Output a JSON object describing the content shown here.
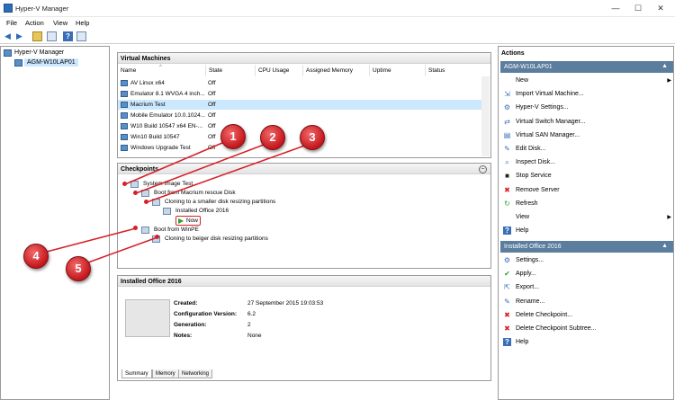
{
  "window": {
    "title": "Hyper-V Manager",
    "minimize": "—",
    "maximize": "☐",
    "close": "✕"
  },
  "menu": [
    "File",
    "Action",
    "View",
    "Help"
  ],
  "tree": {
    "root": "Hyper-V Manager",
    "host": "AGM-W10LAP01"
  },
  "vms": {
    "title": "Virtual Machines",
    "columns": [
      "Name",
      "State",
      "CPU Usage",
      "Assigned Memory",
      "Uptime",
      "Status"
    ],
    "rows": [
      {
        "name": "AV Linux x64",
        "state": "Off"
      },
      {
        "name": "Emulator 8.1 WVGA 4 inch...",
        "state": "Off"
      },
      {
        "name": "Macrium Test",
        "state": "Off"
      },
      {
        "name": "Mobile Emulator 10.0.1024...",
        "state": "Off"
      },
      {
        "name": "W10 Build 10547 x64 EN-...",
        "state": "Off"
      },
      {
        "name": "Win10 Build 10547",
        "state": "Off"
      },
      {
        "name": "Windows Upgrade Test",
        "state": "Off"
      }
    ]
  },
  "checkpoints": {
    "title": "Checkpoints",
    "items": [
      "System Image Test",
      "Boot from Macrium rescue Disk",
      "Cloning to a smaller disk resizing partitions",
      "Installed Office 2016",
      "Now",
      "Boot from WinPE",
      "Cloning to beiger disk resizing partitions"
    ]
  },
  "details": {
    "title": "Installed Office 2016",
    "created_label": "Created:",
    "created": "27 September 2015 19:03:53",
    "config_label": "Configuration Version:",
    "config": "6.2",
    "gen_label": "Generation:",
    "gen": "2",
    "notes_label": "Notes:",
    "notes": "None",
    "tabs": [
      "Summary",
      "Memory",
      "Networking"
    ]
  },
  "actions": {
    "title": "Actions",
    "host_header": "AGM-W10LAP01",
    "host_items": [
      {
        "label": "New",
        "icon": "none",
        "arrow": "▶"
      },
      {
        "label": "Import Virtual Machine...",
        "icon": "import-icon"
      },
      {
        "label": "Hyper-V Settings...",
        "icon": "settings-icon"
      },
      {
        "label": "Virtual Switch Manager...",
        "icon": "switch-icon"
      },
      {
        "label": "Virtual SAN Manager...",
        "icon": "san-icon"
      },
      {
        "label": "Edit Disk...",
        "icon": "edit-disk-icon"
      },
      {
        "label": "Inspect Disk...",
        "icon": "inspect-disk-icon"
      },
      {
        "label": "Stop Service",
        "icon": "stop-icon"
      },
      {
        "label": "Remove Server",
        "icon": "remove-icon"
      },
      {
        "label": "Refresh",
        "icon": "refresh-icon"
      },
      {
        "label": "View",
        "icon": "none",
        "arrow": "▶"
      },
      {
        "label": "Help",
        "icon": "help-icon"
      }
    ],
    "cp_header": "Installed Office 2016",
    "cp_items": [
      {
        "label": "Settings...",
        "icon": "settings-icon"
      },
      {
        "label": "Apply...",
        "icon": "apply-icon"
      },
      {
        "label": "Export...",
        "icon": "export-icon"
      },
      {
        "label": "Rename...",
        "icon": "rename-icon"
      },
      {
        "label": "Delete Checkpoint...",
        "icon": "delete-icon"
      },
      {
        "label": "Delete Checkpoint Subtree...",
        "icon": "delete-subtree-icon"
      },
      {
        "label": "Help",
        "icon": "help-icon"
      }
    ]
  },
  "callouts": [
    "1",
    "2",
    "3",
    "4",
    "5"
  ],
  "colors": {
    "accent": "#5b7d9e",
    "callout": "#c4161c",
    "selection": "#cce8ff"
  }
}
